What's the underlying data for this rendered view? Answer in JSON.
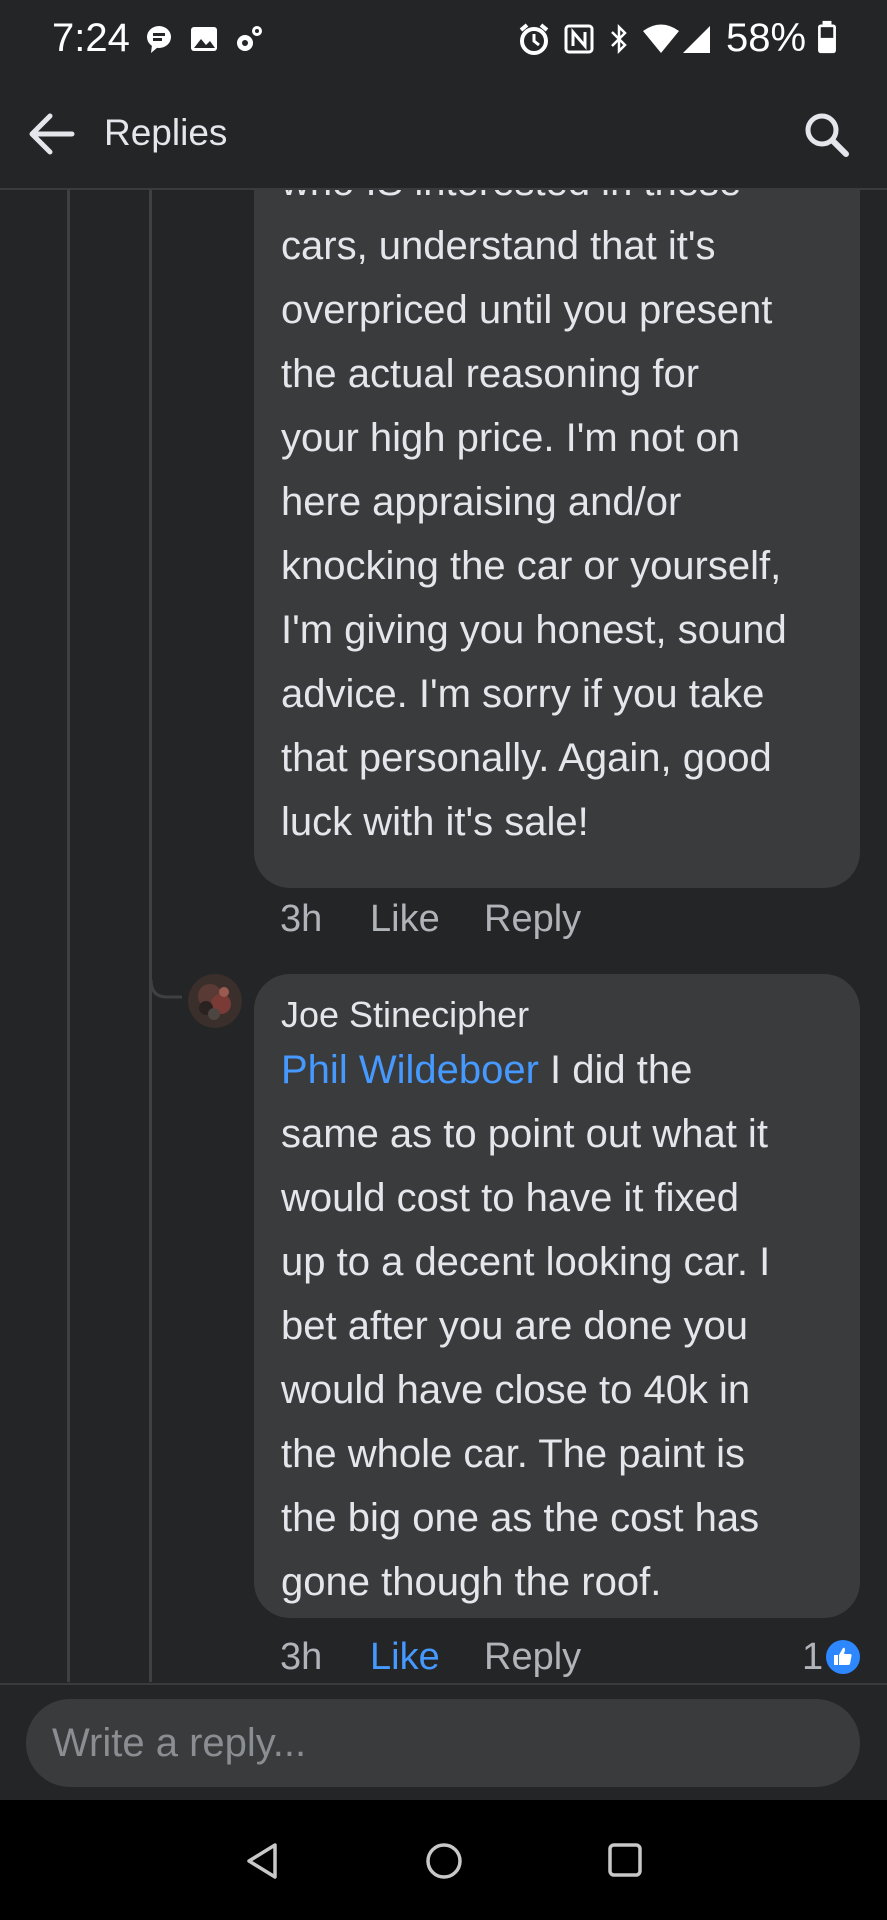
{
  "status_bar": {
    "time": "7:24",
    "battery_percent": "58%",
    "icons": [
      "messenger-icon",
      "gallery-icon",
      "settings-icon",
      "alarm-icon",
      "nfc-icon",
      "bluetooth-icon",
      "wifi-icon",
      "signal-icon",
      "battery-icon"
    ]
  },
  "header": {
    "title": "Replies"
  },
  "comments": [
    {
      "text_lines": [
        "who IS interested in these",
        "cars, understand that it's",
        "overpriced until you present",
        "the actual reasoning for",
        "your high price. I'm not on",
        "here appraising and/or",
        "knocking the car or yourself,",
        "I'm giving you honest, sound",
        "advice. I'm sorry if you take",
        "that personally. Again, good",
        "luck with it's sale!"
      ],
      "time": "3h",
      "like_label": "Like",
      "reply_label": "Reply"
    },
    {
      "author": "Joe Stinecipher",
      "mention": "Phil Wildeboer",
      "first_line_rest": " I did the",
      "text_lines": [
        "same as to point out what it",
        "would cost to have it fixed",
        "up to a decent looking car. I",
        "bet after you are done you",
        "would have close to 40k in",
        "the whole car. The paint is",
        "the big one as the cost has",
        "gone though the roof."
      ],
      "time": "3h",
      "like_label": "Like",
      "reply_label": "Reply",
      "reaction_count": "1"
    }
  ],
  "composer": {
    "placeholder": "Write a reply..."
  },
  "colors": {
    "background": "#242527",
    "bubble": "#3a3b3c",
    "link": "#4599ff",
    "meta": "#b0b3b8"
  }
}
